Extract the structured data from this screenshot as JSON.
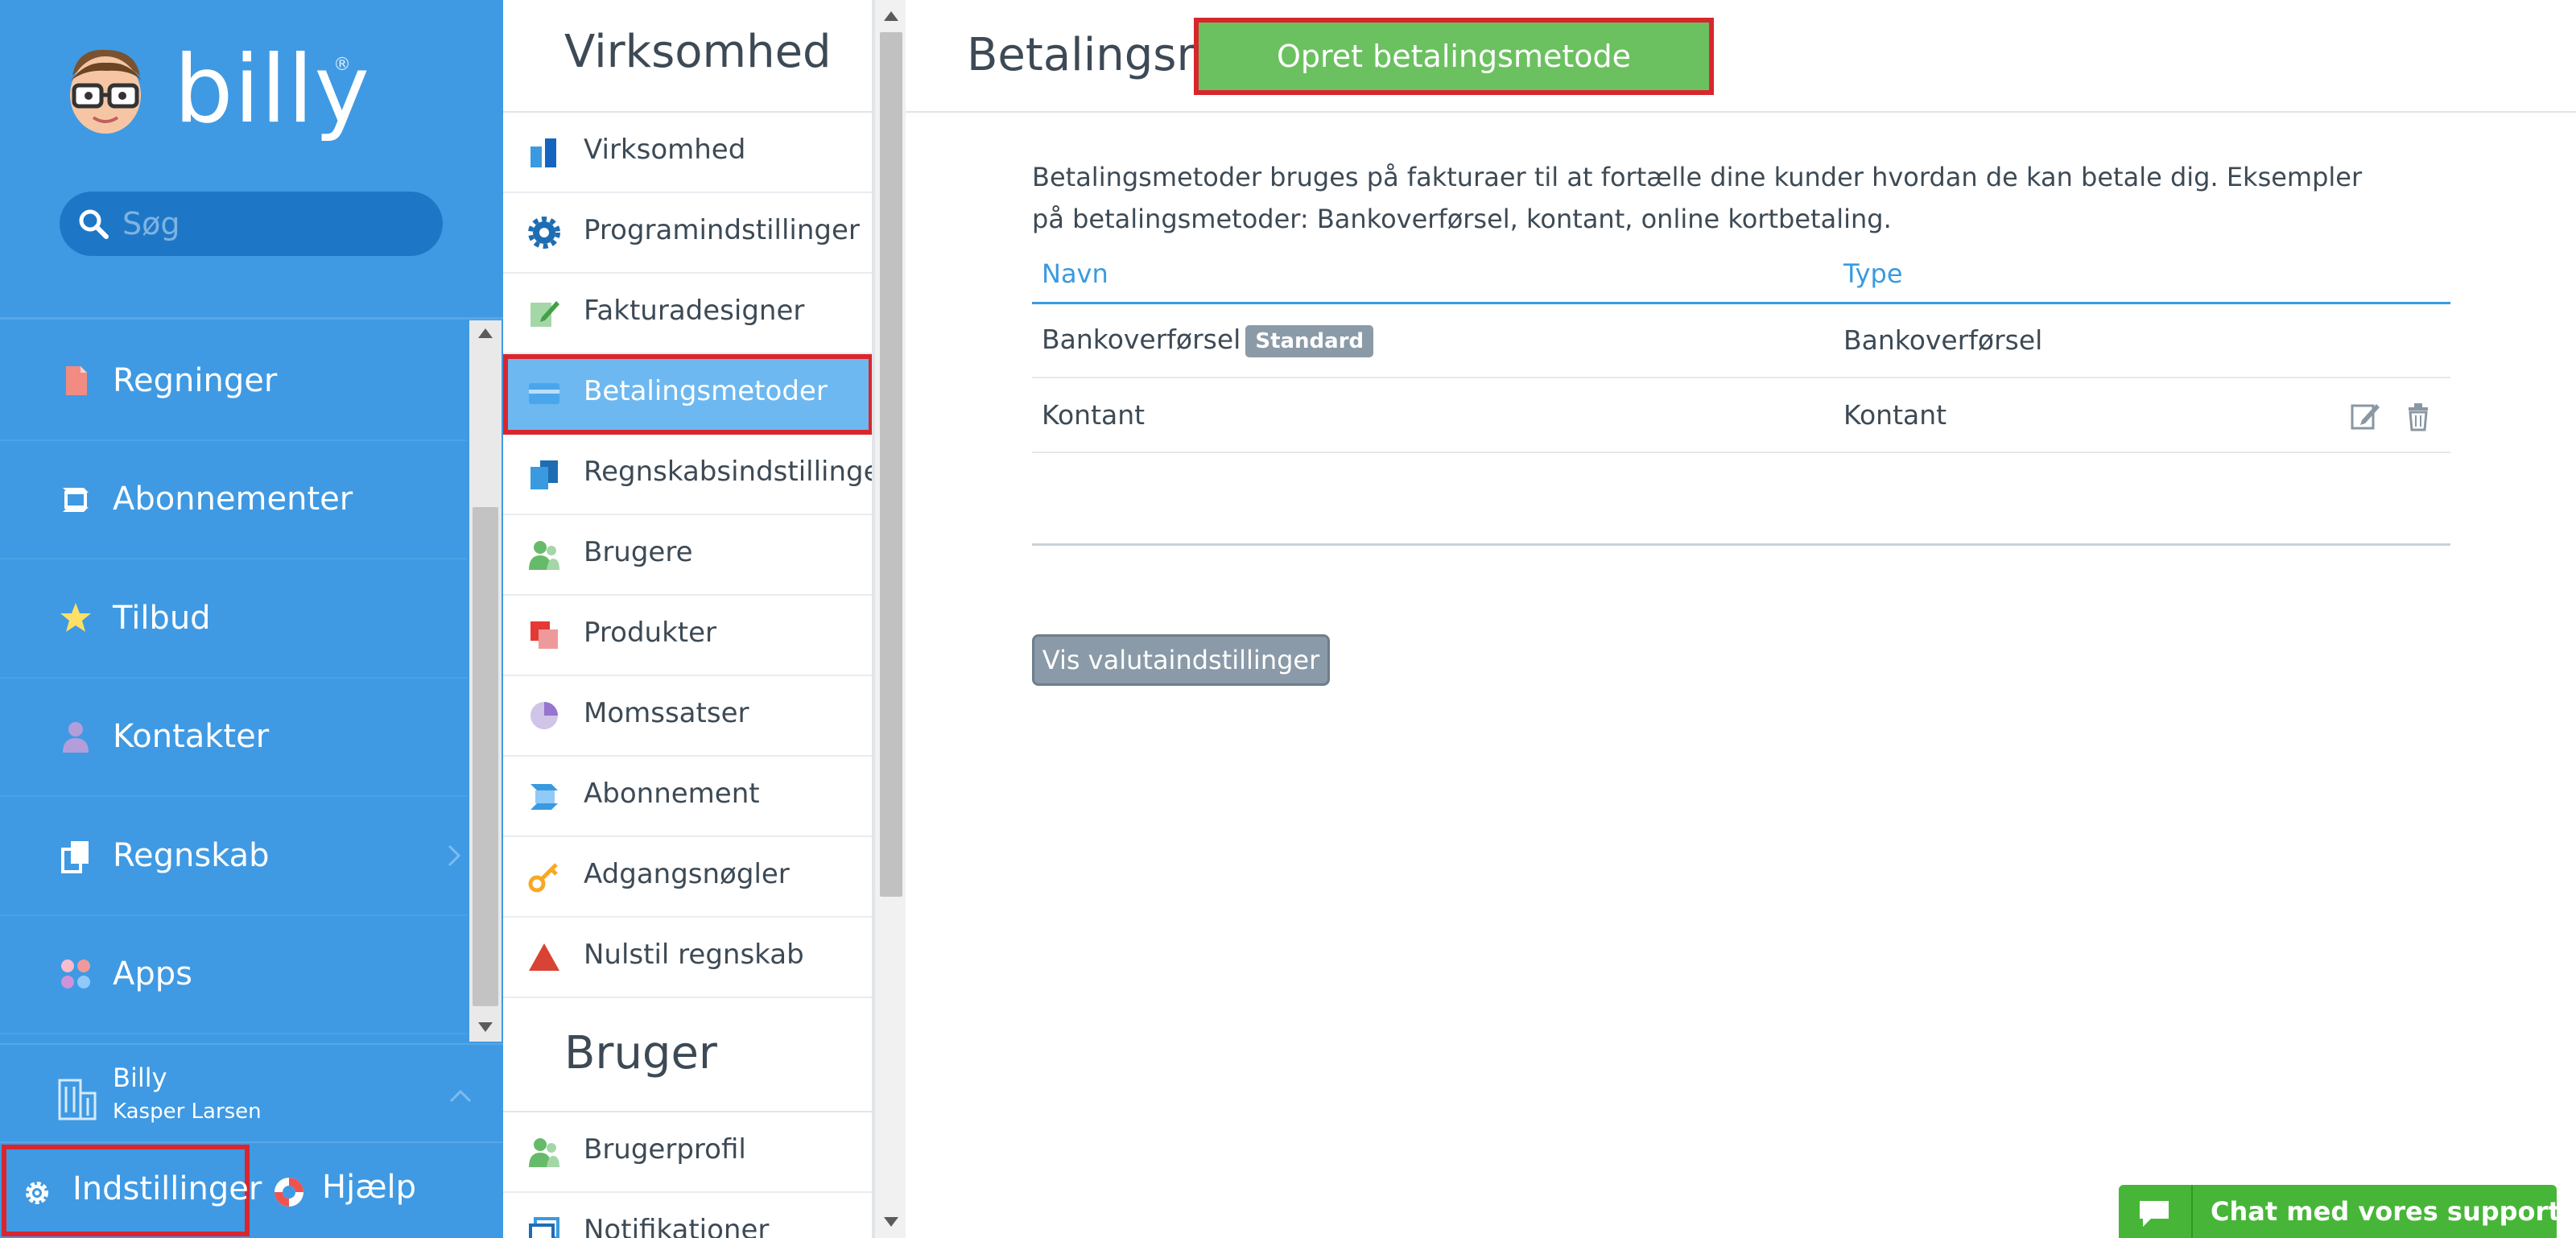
{
  "app": {
    "name": "billy",
    "registered_mark": "®"
  },
  "search": {
    "placeholder": "Søg"
  },
  "sidebar": {
    "items": [
      {
        "label": "Regninger",
        "icon": "bill-icon",
        "color": "#f28b82"
      },
      {
        "label": "Abonnementer",
        "icon": "subscriptions-icon",
        "color": "#ffffff"
      },
      {
        "label": "Tilbud",
        "icon": "star-icon",
        "color": "#ffe066"
      },
      {
        "label": "Kontakter",
        "icon": "person-icon",
        "color": "#b39ddb"
      },
      {
        "label": "Regnskab",
        "icon": "documents-icon",
        "color": "#ffffff",
        "has_submenu": true
      },
      {
        "label": "Apps",
        "icon": "apps-icon",
        "color": "#f8bbd0"
      }
    ],
    "org": {
      "name": "Billy",
      "user": "Kasper Larsen"
    },
    "bottom": {
      "settings": "Indstillinger",
      "help": "Hjælp"
    }
  },
  "submenu": {
    "company": {
      "title": "Virksomhed",
      "items": [
        {
          "label": "Virksomhed",
          "icon": "company-icon"
        },
        {
          "label": "Programindstillinger",
          "icon": "gear-icon"
        },
        {
          "label": "Fakturadesigner",
          "icon": "invoice-designer-icon"
        },
        {
          "label": "Betalingsmetoder",
          "icon": "card-icon",
          "active": true
        },
        {
          "label": "Regnskabsindstillinger",
          "icon": "accounting-settings-icon"
        },
        {
          "label": "Brugere",
          "icon": "users-icon"
        },
        {
          "label": "Produkter",
          "icon": "products-icon"
        },
        {
          "label": "Momssatser",
          "icon": "pie-icon"
        },
        {
          "label": "Abonnement",
          "icon": "subscription-icon"
        },
        {
          "label": "Adgangsnøgler",
          "icon": "key-icon"
        },
        {
          "label": "Nulstil regnskab",
          "icon": "warning-icon"
        }
      ]
    },
    "user": {
      "title": "Bruger",
      "items": [
        {
          "label": "Brugerprofil",
          "icon": "user-profile-icon"
        },
        {
          "label": "Notifikationer",
          "icon": "notifications-icon"
        }
      ]
    }
  },
  "main": {
    "title": "Betalingsmetoder",
    "create_button": "Opret betalingsmetode",
    "description": "Betalingsmetoder bruges på fakturaer til at fortælle dine kunder hvordan de kan betale dig. Eksempler på betalingsmetoder: Bankoverførsel, kontant, online kortbetaling.",
    "table": {
      "columns": [
        "Navn",
        "Type"
      ],
      "rows": [
        {
          "name": "Bankoverførsel",
          "badge": "Standard",
          "type": "Bankoverførsel",
          "actions": false
        },
        {
          "name": "Kontant",
          "badge": "",
          "type": "Kontant",
          "actions": true
        }
      ]
    },
    "currency_button": "Vis valutaindstillinger"
  },
  "chat": {
    "label": "Chat med vores support"
  },
  "colors": {
    "sidebar": "#3f9ae3",
    "accent": "#3a9ae0",
    "primary_button": "#6bc15f",
    "chat": "#47b638",
    "highlight_border": "#d9262d",
    "active_item": "#6db8f0"
  }
}
